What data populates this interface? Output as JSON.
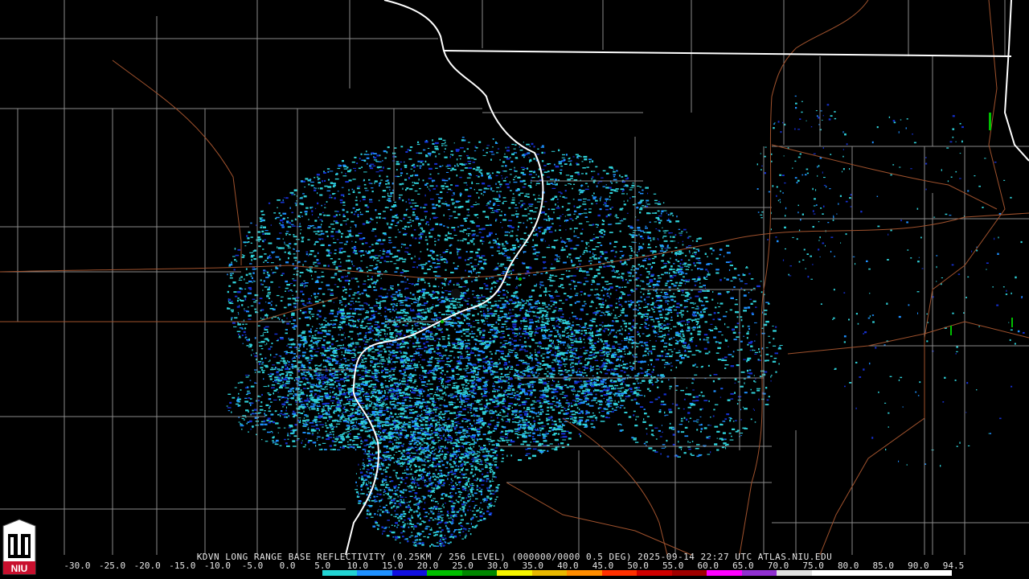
{
  "caption": "KDVN LONG RANGE BASE REFLECTIVITY (0.25KM / 256 LEVEL) (000000/0000 0.5 DEG) 2025-09-14 22:27 UTC  ATLAS.NIU.EDU",
  "scale": {
    "labels": [
      "-30.0",
      "-25.0",
      "-20.0",
      "-15.0",
      "-10.0",
      "-5.0",
      "0.0",
      "5.0",
      "10.0",
      "15.0",
      "20.0",
      "25.0",
      "30.0",
      "35.0",
      "40.0",
      "45.0",
      "50.0",
      "55.0",
      "60.0",
      "65.0",
      "70.0",
      "75.0",
      "80.0",
      "85.0",
      "90.0",
      "94.5"
    ],
    "colors": [
      "#000000",
      "#000000",
      "#000000",
      "#000000",
      "#000000",
      "#000000",
      "#000000",
      "#22d3d3",
      "#1e90ff",
      "#1010e0",
      "#00c000",
      "#008800",
      "#f5f500",
      "#e8b800",
      "#ff8c00",
      "#ff3000",
      "#d00000",
      "#a00000",
      "#ff00ff",
      "#9030d0",
      "#e0e0e0",
      "#ffffff",
      "#ffffff",
      "#ffffff",
      "#ffffff"
    ]
  },
  "logo": {
    "text": "NIU",
    "color": "#c8102e"
  },
  "colors": {
    "background": "#000000",
    "county_lines": "#8a8a8a",
    "state_lines": "#ffffff",
    "roads": "#a0522d",
    "echo_light": "#2fd0d8",
    "echo_mid": "#1e90ff",
    "echo_dark": "#1530d0"
  }
}
